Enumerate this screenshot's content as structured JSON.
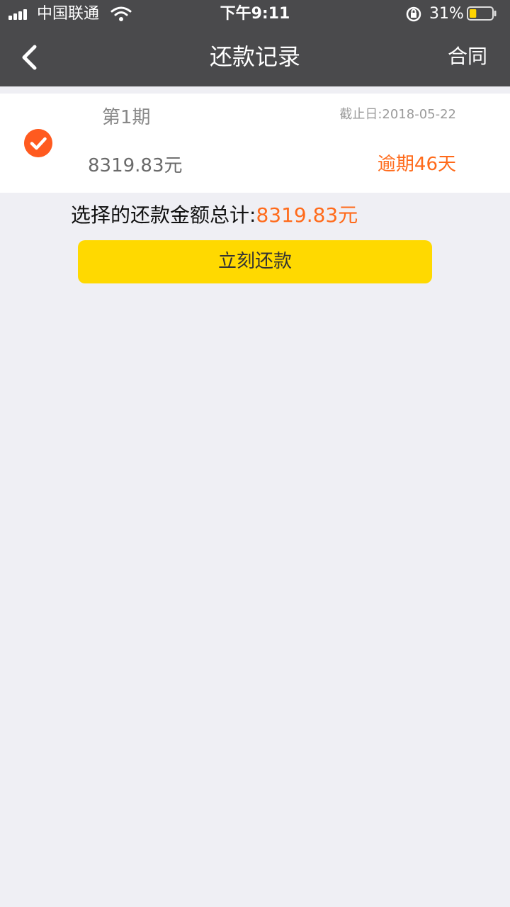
{
  "status_bar": {
    "carrier": "中国联通",
    "time": "下午9:11",
    "battery_percent": "31%",
    "battery_level": 0.31,
    "icons": [
      "signal-icon",
      "wifi-icon",
      "rotation-lock-icon",
      "battery-icon"
    ]
  },
  "nav": {
    "title": "还款记录",
    "right_link": "合同",
    "back_icon": "chevron-left-icon"
  },
  "installment": {
    "period": "第1期",
    "due_date": "截止日:2018-05-22",
    "amount": "8319.83元",
    "overdue": "逾期46天",
    "selected": true,
    "check_icon": "checkmark-circle-icon"
  },
  "summary": {
    "label": "选择的还款金额总计:",
    "amount": "8319.83元"
  },
  "actions": {
    "pay_now": "立刻还款"
  },
  "colors": {
    "header_bg": "#4a4a4c",
    "page_bg": "#efeff4",
    "accent_orange": "#ff6a1a",
    "button_yellow": "#ffd900",
    "check_orange": "#ff5a1f"
  }
}
